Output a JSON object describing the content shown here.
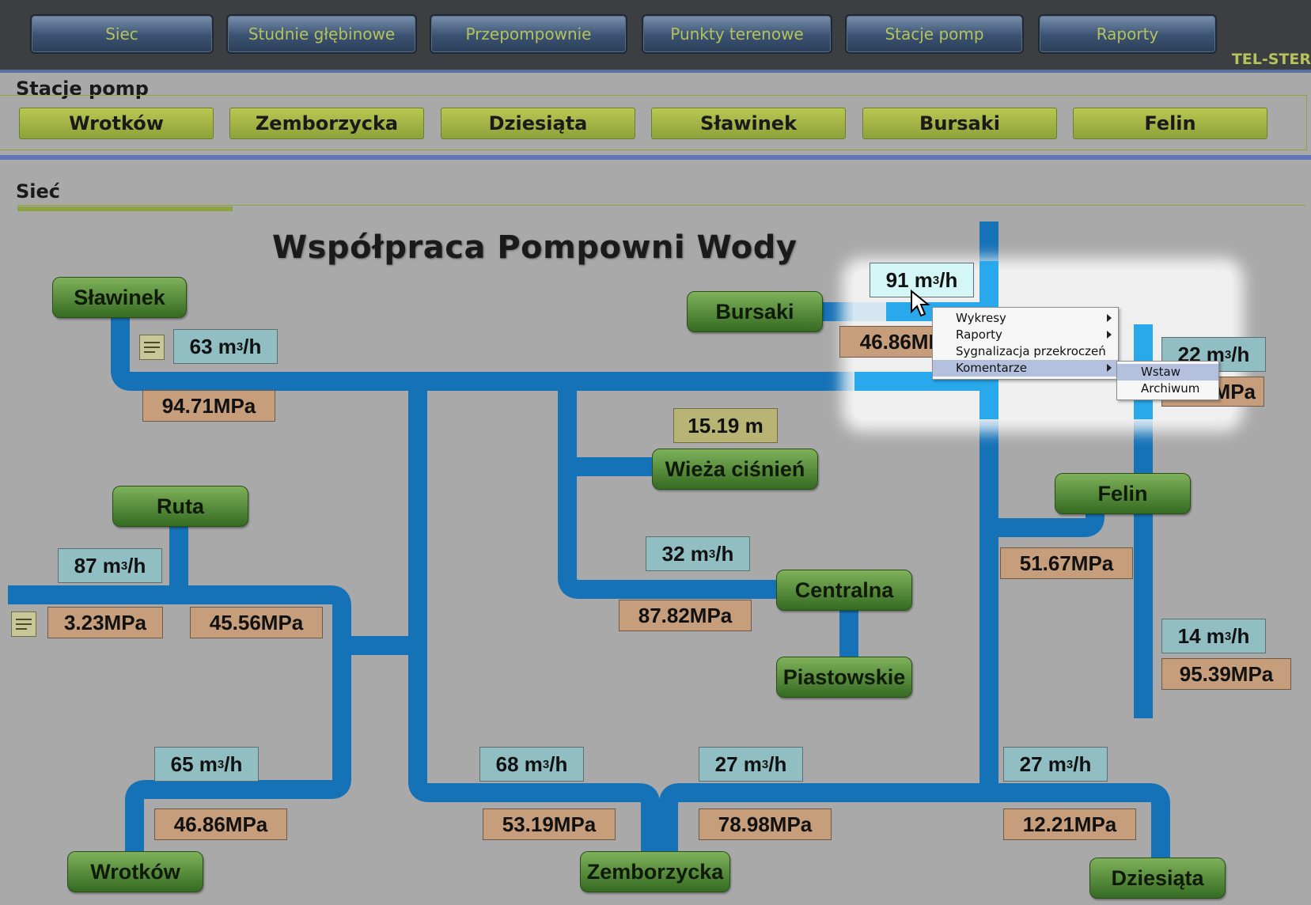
{
  "nav": {
    "items": [
      "Siec",
      "Studnie głębinowe",
      "Przepompownie",
      "Punkty terenowe",
      "Stacje pomp",
      "Raporty"
    ],
    "brand": "TEL-STER"
  },
  "stations": {
    "heading": "Stacje pomp",
    "items": [
      "Wrotków",
      "Zemborzycka",
      "Dziesiąta",
      "Sławinek",
      "Bursaki",
      "Felin"
    ]
  },
  "tab": {
    "label": "Sieć"
  },
  "diagram": {
    "title": "Współpraca Pompowni Wody",
    "nodes": {
      "slawinek": "Sławinek",
      "bursaki": "Bursaki",
      "wieza": "Wieża ciśnień",
      "felin": "Felin",
      "ruta": "Ruta",
      "centralna": "Centralna",
      "piastowskie": "Piastowskie",
      "wrotkow": "Wrotków",
      "zemborzycka": "Zemborzycka",
      "dziesiata": "Dziesiąta"
    },
    "unit": "m",
    "unit_exp": "3",
    "unit_tail": "/h",
    "flows": {
      "bursaki": "91",
      "slawinek": "63",
      "felin_top": "22",
      "ruta": "87",
      "centralna": "32",
      "felin_bottom": "14",
      "wrotkow": "65",
      "zemborzycka": "68",
      "mid": "27",
      "dziesiata": "27"
    },
    "pressures": {
      "bursaki": "46.86MPa",
      "slawinek": "94.71MPa",
      "felin_top": "3MPa",
      "ruta_left": "3.23MPa",
      "ruta_right": "45.56MPa",
      "centralna": "87.82MPa",
      "felin": "51.67MPa",
      "felin_bottom": "95.39MPa",
      "wrotkow": "46.86MPa",
      "zemborzycka": "53.19MPa",
      "mid": "78.98MPa",
      "dziesiata": "12.21MPa"
    },
    "level": "15.19 m"
  },
  "context_menu": {
    "items": [
      "Wykresy",
      "Raporty",
      "Sygnalizacja przekroczeń",
      "Komentarze"
    ],
    "submenu": [
      "Wstaw",
      "Archiwum"
    ]
  },
  "colors": {
    "pipe": "#1672b6",
    "pipe_highlight": "#29a8ec",
    "node": "#4d8a35",
    "flow_box": "#91bec3",
    "pressure_box": "#c69e7c"
  }
}
